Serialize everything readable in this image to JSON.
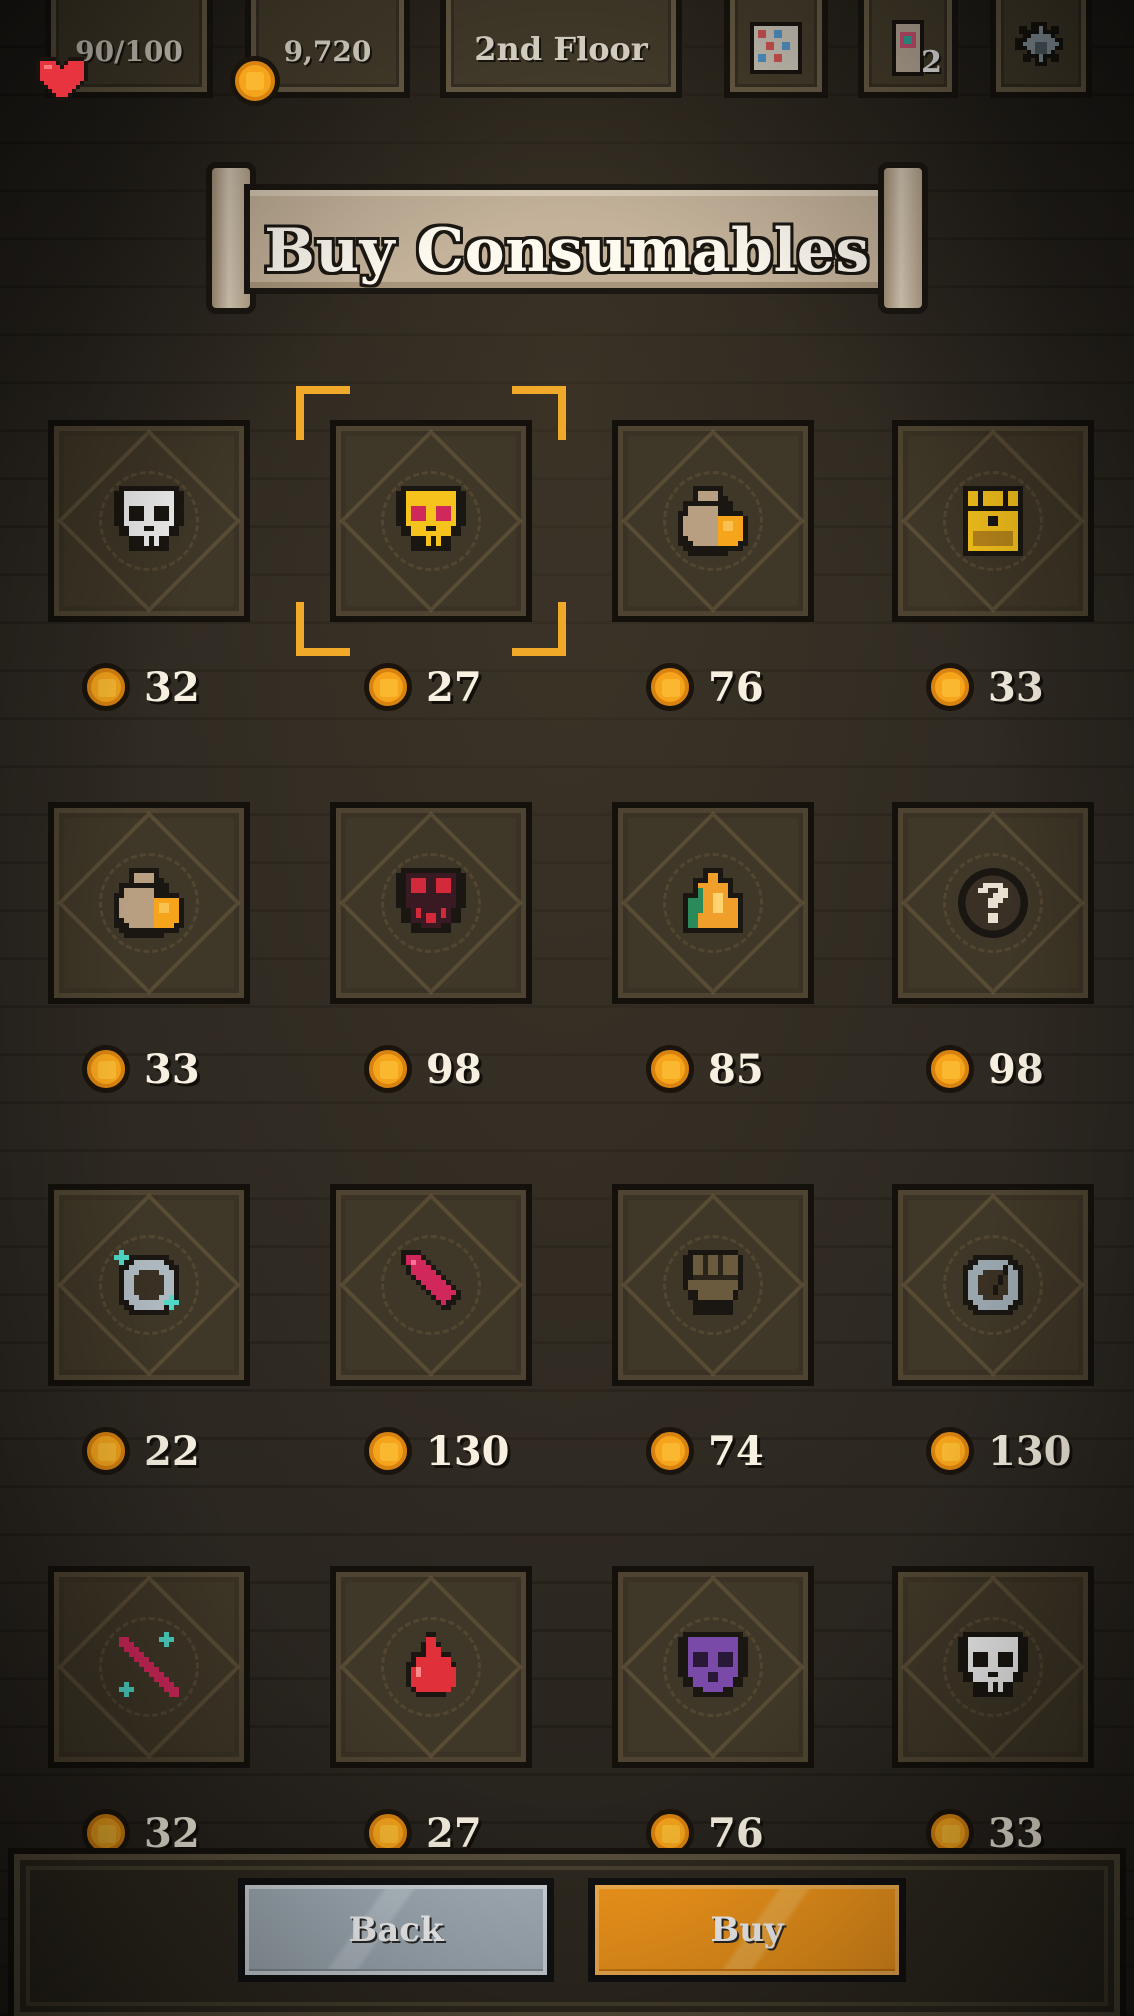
{
  "hud": {
    "health": "90/100",
    "gold": "9,720",
    "floor": "2nd Floor",
    "relic_count": "2",
    "icons": [
      "heart-icon",
      "coin-icon",
      "map-icon",
      "relic-icon",
      "gear-icon"
    ]
  },
  "banner": {
    "title": "Buy Consumables"
  },
  "items": [
    {
      "icon": "skull-icon",
      "price": "32",
      "color": "#f2f2f2"
    },
    {
      "icon": "gold-skull-icon",
      "price": "27",
      "color": "#f6c21c",
      "selected": true
    },
    {
      "icon": "coin-pouch-icon",
      "price": "76",
      "color": "#f5a41c"
    },
    {
      "icon": "treasure-chest-icon",
      "price": "33",
      "color": "#f6c21c"
    },
    {
      "icon": "coin-pouch-icon",
      "price": "33",
      "color": "#f5a41c"
    },
    {
      "icon": "red-eyed-skull-icon",
      "price": "98",
      "color": "#d22a3a"
    },
    {
      "icon": "fire-tent-icon",
      "price": "85",
      "color": "#f0a02a"
    },
    {
      "icon": "mystery-icon",
      "price": "98",
      "color": "#e8e0d0"
    },
    {
      "icon": "sparkle-ring-icon",
      "price": "22",
      "color": "#4fd8c8"
    },
    {
      "icon": "crimson-dagger-icon",
      "price": "130",
      "color": "#d0285a"
    },
    {
      "icon": "fist-icon",
      "price": "74",
      "color": "#2a241b"
    },
    {
      "icon": "cracked-ring-icon",
      "price": "130",
      "color": "#9aa6ae"
    },
    {
      "icon": "sparkle-dagger-icon",
      "price": "32",
      "color": "#d0285a"
    },
    {
      "icon": "blood-drop-icon",
      "price": "27",
      "color": "#e0303a"
    },
    {
      "icon": "purple-skull-icon",
      "price": "76",
      "color": "#7a4aa8"
    },
    {
      "icon": "skull-icon",
      "price": "33",
      "color": "#f2f2f2"
    }
  ],
  "buttons": {
    "back": "Back",
    "buy": "Buy"
  },
  "colors": {
    "accent": "#f79a1c",
    "selector": "#f0a928",
    "back": "#a6b2bb"
  }
}
